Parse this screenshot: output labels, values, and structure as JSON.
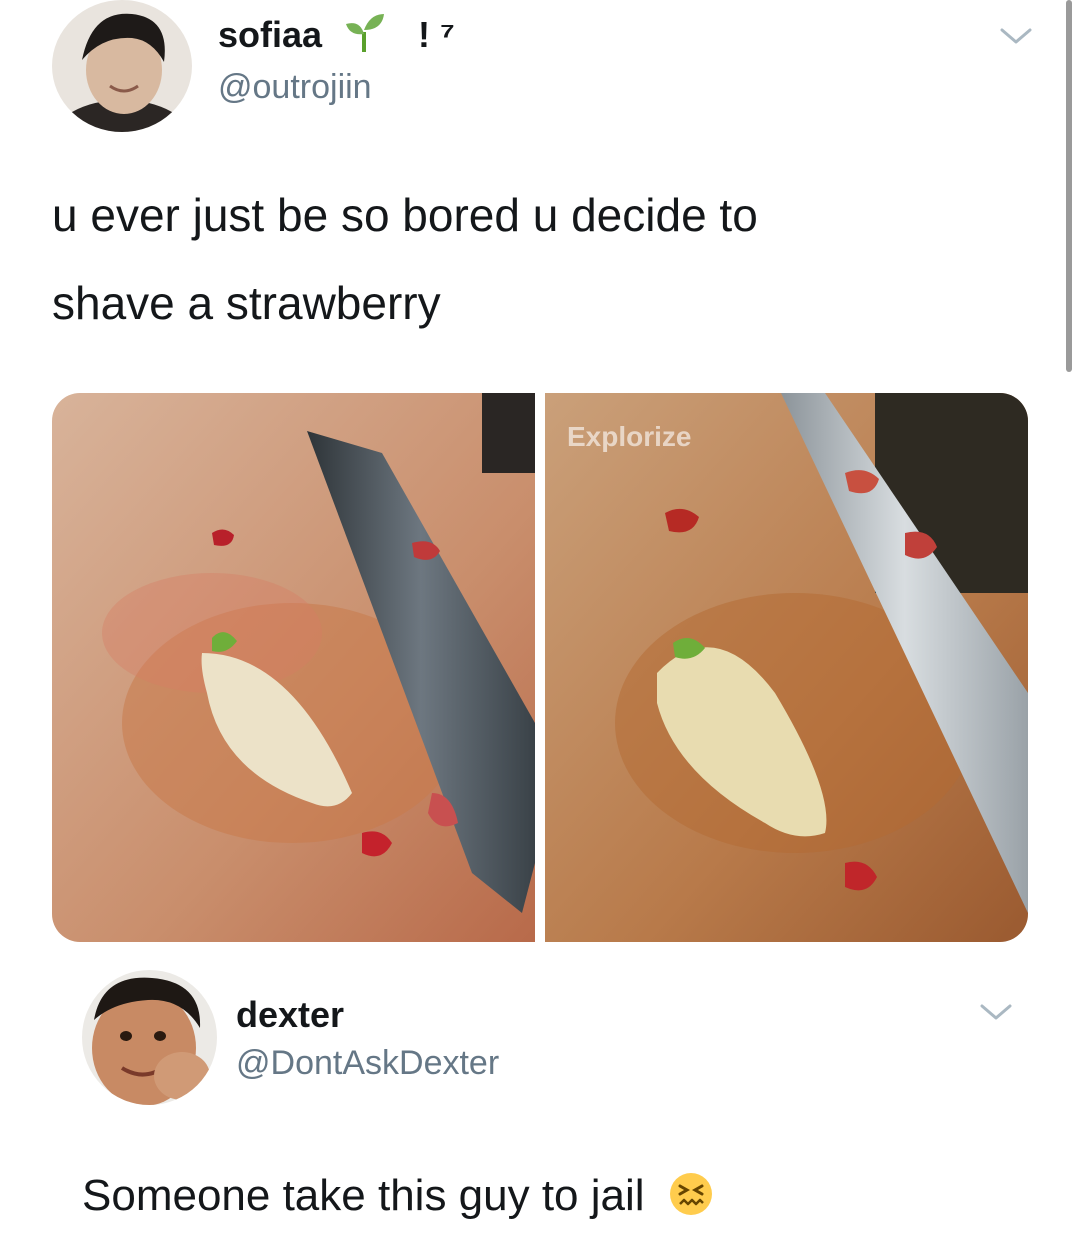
{
  "tweet": {
    "display_name": "sofiaa",
    "name_suffix": "! ⁷",
    "handle": "@outrojiin",
    "text_line1": "u ever just be so bored u decide to",
    "text_line2": "shave a strawberry",
    "images": [
      {
        "icon": "strawberry-photo-left"
      },
      {
        "icon": "strawberry-photo-right",
        "watermark": "Explorize"
      }
    ]
  },
  "reply": {
    "display_name": "dexter",
    "handle": "@DontAskDexter",
    "text": "Someone take this guy to jail",
    "emoji_icon": "confounded-face-icon"
  },
  "colors": {
    "text": "#14171a",
    "handle": "#657786",
    "chevron": "#aab8c2"
  }
}
